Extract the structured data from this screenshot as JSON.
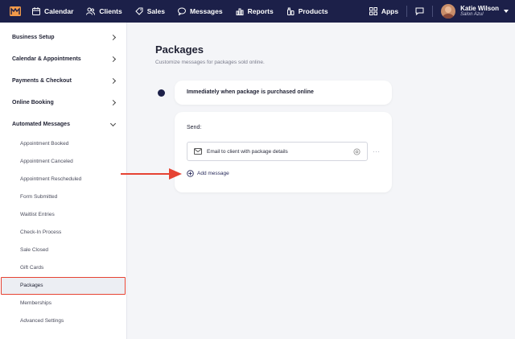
{
  "topbar": {
    "nav": [
      {
        "label": "Calendar",
        "icon": "calendar-icon"
      },
      {
        "label": "Clients",
        "icon": "users-icon"
      },
      {
        "label": "Sales",
        "icon": "tag-icon"
      },
      {
        "label": "Messages",
        "icon": "message-icon"
      },
      {
        "label": "Reports",
        "icon": "chart-icon"
      },
      {
        "label": "Products",
        "icon": "bottle-icon"
      }
    ],
    "apps_label": "Apps",
    "user_name": "Katie Wilson",
    "user_sub": "Salon Azul"
  },
  "sidebar": {
    "sections": [
      {
        "label": "Business Setup"
      },
      {
        "label": "Calendar & Appointments"
      },
      {
        "label": "Payments & Checkout"
      },
      {
        "label": "Online Booking"
      },
      {
        "label": "Automated Messages"
      }
    ],
    "sub_items": [
      "Appointment Booked",
      "Appointment Canceled",
      "Appointment Rescheduled",
      "Form Submitted",
      "Waitlist Entries",
      "Check-In Process",
      "Sale Closed",
      "Gift Cards",
      "Packages",
      "Memberships",
      "Advanced Settings"
    ],
    "active_item": "Packages"
  },
  "main": {
    "title": "Packages",
    "subtitle": "Customize messages for packages sold online.",
    "trigger": "Immediately when package is purchased online",
    "send_label": "Send:",
    "message": "Email to client with package details",
    "more": "···",
    "add_message": "Add message"
  },
  "colors": {
    "nav_bg": "#1c2049",
    "highlight_border": "#e64333",
    "arrow": "#e64333"
  }
}
